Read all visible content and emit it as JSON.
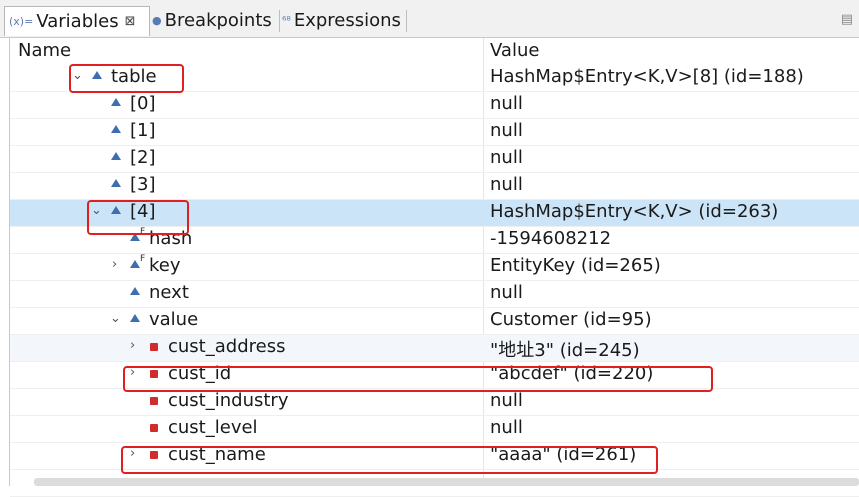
{
  "tabs": {
    "variables": {
      "icon": "(x)=",
      "label": "Variables",
      "close": "⊠"
    },
    "breakpoints": {
      "label": "Breakpoints"
    },
    "expressions": {
      "label": "Expressions"
    }
  },
  "columns": {
    "name": "Name",
    "value": "Value"
  },
  "rows": [
    {
      "name": "table",
      "value": "HashMap$Entry<K,V>[8]  (id=188)"
    },
    {
      "name": "[0]",
      "value": "null"
    },
    {
      "name": "[1]",
      "value": "null"
    },
    {
      "name": "[2]",
      "value": "null"
    },
    {
      "name": "[3]",
      "value": "null"
    },
    {
      "name": "[4]",
      "value": "HashMap$Entry<K,V>  (id=263)"
    },
    {
      "name": "hash",
      "value": "-1594608212"
    },
    {
      "name": "key",
      "value": "EntityKey  (id=265)"
    },
    {
      "name": "next",
      "value": "null"
    },
    {
      "name": "value",
      "value": "Customer  (id=95)"
    },
    {
      "name": "cust_address",
      "value": "\"地址3\" (id=245)"
    },
    {
      "name": "cust_id",
      "value": "\"abcdef\" (id=220)"
    },
    {
      "name": "cust_industry",
      "value": "null"
    },
    {
      "name": "cust_level",
      "value": "null"
    },
    {
      "name": "cust_name",
      "value": "\"aaaa\" (id=261)"
    }
  ],
  "glyphs": {
    "expanded": "⌄",
    "collapsed": "›",
    "final_marker": "F"
  },
  "colors": {
    "highlight_box": "#e02020",
    "selected_row": "#cce4f7",
    "variable_icon": "#3d6fb0",
    "field_icon": "#d22b2b"
  }
}
